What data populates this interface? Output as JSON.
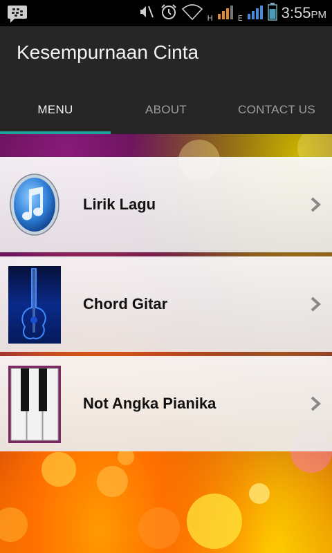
{
  "status_bar": {
    "time": "3:55",
    "ampm": "PM",
    "network_1": "H",
    "network_2": "E",
    "icons": [
      "bbm-icon",
      "mute-icon",
      "alarm-icon",
      "wifi-icon",
      "signal-icon",
      "battery-icon"
    ]
  },
  "app": {
    "title": "Kesempurnaan Cinta"
  },
  "tabs": [
    {
      "label": "MENU",
      "active": true
    },
    {
      "label": "ABOUT",
      "active": false
    },
    {
      "label": "CONTACT US",
      "active": false
    }
  ],
  "menu": {
    "items": [
      {
        "label": "Lirik Lagu",
        "icon": "music-note-icon"
      },
      {
        "label": "Chord Gitar",
        "icon": "guitar-icon"
      },
      {
        "label": "Not Angka Pianika",
        "icon": "piano-keys-icon"
      }
    ]
  },
  "colors": {
    "tab_indicator": "#1ba39c",
    "action_bar": "#262626"
  }
}
